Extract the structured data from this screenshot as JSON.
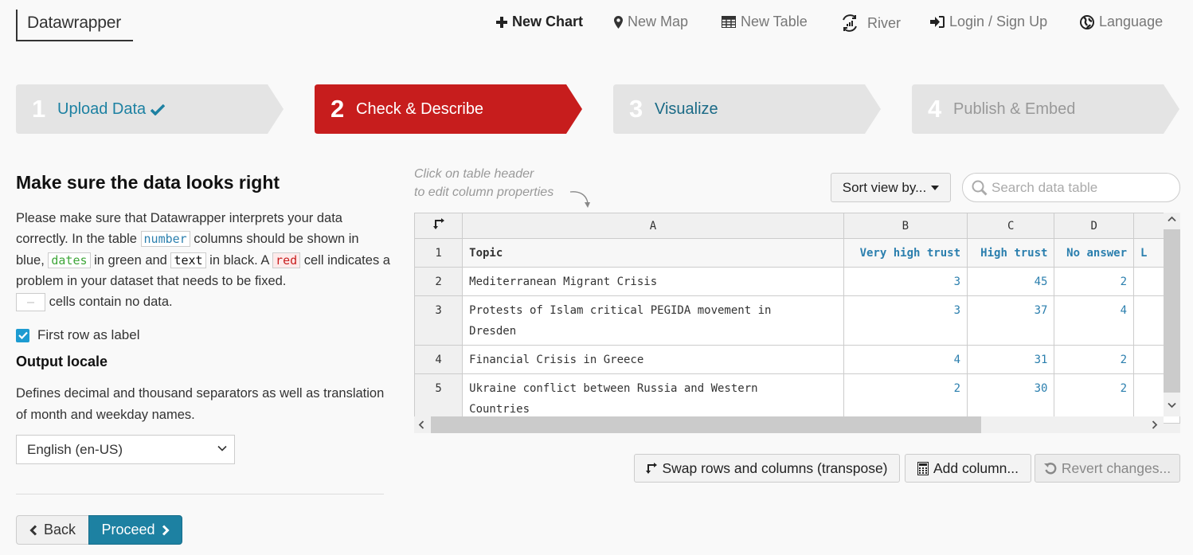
{
  "app": {
    "logo": "Datawrapper"
  },
  "nav": {
    "items": [
      {
        "label": "New Chart",
        "icon": "plus-icon"
      },
      {
        "label": "New Map",
        "icon": "map-marker-icon"
      },
      {
        "label": "New Table",
        "icon": "table-icon"
      },
      {
        "label": "River",
        "icon": "river-icon"
      },
      {
        "label": "Login / Sign Up",
        "icon": "sign-in-icon"
      },
      {
        "label": "Language",
        "icon": "globe-icon"
      }
    ]
  },
  "steps": [
    {
      "number": "1",
      "label": "Upload Data",
      "state": "done",
      "check_icon": "check-icon"
    },
    {
      "number": "2",
      "label": "Check & Describe",
      "state": "active"
    },
    {
      "number": "3",
      "label": "Visualize",
      "state": "available"
    },
    {
      "number": "4",
      "label": "Publish & Embed",
      "state": "disabled"
    }
  ],
  "colors": {
    "active_step": "#c71d1d",
    "inactive_step": "#e4e4e4",
    "link_blue": "#1d81a2",
    "number_blue": "#2b7fae",
    "date_green": "#3ea638",
    "error_red": "#c81e1e",
    "checkbox_blue": "#1d9bd1"
  },
  "left": {
    "title": "Make sure the data looks right",
    "desc": {
      "p1": "Please make sure that Datawrapper interprets your data correctly. In the table ",
      "code_number": "number",
      "p2": " columns should be shown in blue, ",
      "code_dates": "dates",
      "p3": " in green and ",
      "code_text": "text",
      "p4": " in black. A ",
      "code_red": "red",
      "p5": " cell indicates a problem in your dataset that needs to be fixed.",
      "code_empty": "—",
      "p6": " cells contain no data."
    },
    "first_row_label": "First row as label",
    "first_row_checked": true,
    "locale_title": "Output locale",
    "locale_desc": "Defines decimal and thousand separators as well as translation of month and weekday names.",
    "locale_value": "English (en-US)",
    "back_label": "Back",
    "proceed_label": "Proceed"
  },
  "right": {
    "hint_line1": "Click on table header",
    "hint_line2": "to edit column properties",
    "sort_label": "Sort view by...",
    "search_placeholder": "Search data table",
    "search_value": "",
    "table": {
      "column_letters": [
        "A",
        "B",
        "C",
        "D",
        ""
      ],
      "row_numbers": [
        "1",
        "2",
        "3",
        "4",
        "5"
      ],
      "header_row": [
        "Topic",
        "Very high trust",
        "High trust",
        "No answer",
        "L"
      ],
      "rows": [
        [
          "Mediterranean Migrant Crisis",
          "3",
          "45",
          "2",
          ""
        ],
        [
          "Protests of Islam critical PEGIDA movement in Dresden",
          "3",
          "37",
          "4",
          ""
        ],
        [
          "Financial Crisis in Greece",
          "4",
          "31",
          "2",
          ""
        ],
        [
          "Ukraine conflict between Russia and Western Countries",
          "2",
          "30",
          "2",
          ""
        ]
      ]
    },
    "actions": {
      "transpose": "Swap rows and columns (transpose)",
      "add_column": "Add column...",
      "revert": "Revert changes..."
    }
  }
}
